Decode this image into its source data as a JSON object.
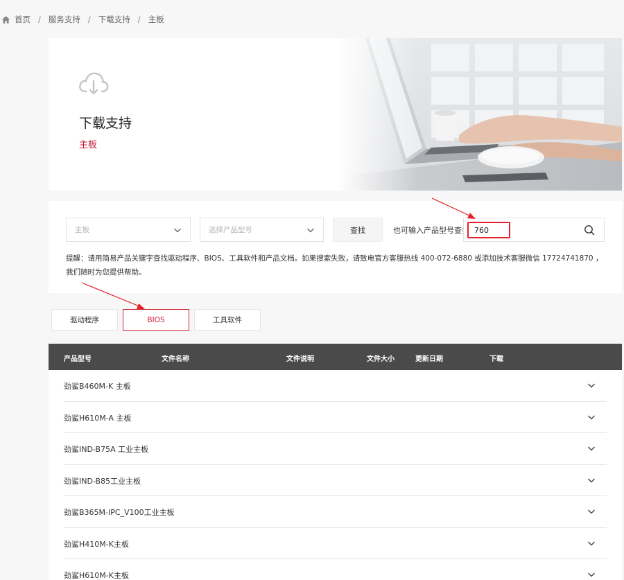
{
  "breadcrumb": {
    "items": [
      "首页",
      "服务支持",
      "下载支持",
      "主板"
    ]
  },
  "hero": {
    "title": "下载支持",
    "subtitle": "主板"
  },
  "search": {
    "category_select": "主板",
    "model_select_placeholder": "选择产品型号",
    "search_button": "查找",
    "model_label": "也可输入产品型号查找",
    "model_value": "760",
    "tip": "提醒：请用简易产品关键字查找驱动程序、BIOS、工具软件和产品文档。如果搜索失败，请致电官方客服热线 400-072-6880 或添加技术客服微信 17724741870 ，我们随时为您提供帮助。"
  },
  "tabs": [
    {
      "label": "驱动程序",
      "active": false
    },
    {
      "label": "BIOS",
      "active": true
    },
    {
      "label": "工具软件",
      "active": false
    }
  ],
  "table": {
    "headers": [
      "产品型号",
      "文件名称",
      "文件说明",
      "文件大小",
      "更新日期",
      "下载"
    ],
    "rows": [
      "劲鲨B460M-K 主板",
      "劲鲨H610M-A 主板",
      "劲鲨IND-B75A 工业主板",
      "劲鲨IND-B85工业主板",
      "劲鲨B365M-IPC_V100工业主板",
      "劲鲨H410M-K主板",
      "劲鲨H610M-K主板"
    ]
  },
  "colors": {
    "accent": "#c8102e",
    "annotation": "#e6202a",
    "table_header": "#4a4a4a"
  }
}
